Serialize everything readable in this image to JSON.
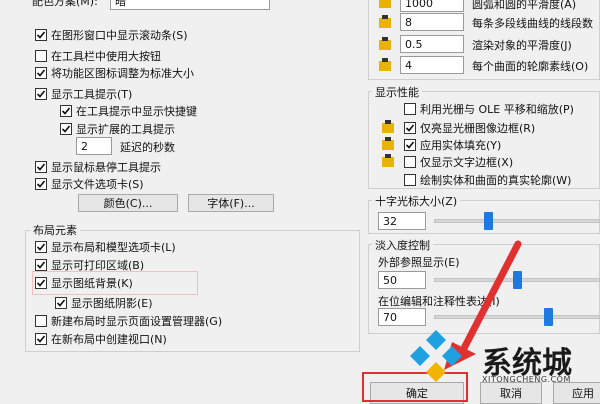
{
  "left": {
    "top_partial_label": "配色方案(M):",
    "top_partial_value": "暗",
    "display_options": [
      {
        "label": "在图形窗口中显示滚动条(S)",
        "checked": true
      },
      {
        "label": "在工具栏中使用大按钮",
        "checked": false
      },
      {
        "label": "将功能区图标调整为标准大小",
        "checked": true
      },
      {
        "label": "显示工具提示(T)",
        "checked": true
      }
    ],
    "tooltip_sub": [
      {
        "label": "在工具提示中显示快捷键",
        "checked": true
      },
      {
        "label": "显示扩展的工具提示",
        "checked": true
      }
    ],
    "delay_value": "2",
    "delay_label": "延迟的秒数",
    "more_options": [
      {
        "label": "显示鼠标悬停工具提示",
        "checked": true
      },
      {
        "label": "显示文件选项卡(S)",
        "checked": true
      }
    ],
    "color_button": "颜色(C)...",
    "font_button": "字体(F)...",
    "layout_group_title": "布局元素",
    "layout_options": [
      {
        "label": "显示布局和模型选项卡(L)",
        "checked": true
      },
      {
        "label": "显示可打印区域(B)",
        "checked": true
      },
      {
        "label": "显示图纸背景(K)",
        "checked": true
      }
    ],
    "layout_sub": {
      "label": "显示图纸阴影(E)",
      "checked": true
    },
    "layout_more": [
      {
        "label": "新建布局时显示页面设置管理器(G)",
        "checked": false
      },
      {
        "label": "在新布局中创建视口(N)",
        "checked": true
      }
    ]
  },
  "right": {
    "resolution_rows": [
      {
        "value": "1000",
        "label": "圆弧和圆的平滑度(A)"
      },
      {
        "value": "8",
        "label": "每条多段线曲线的线段数"
      },
      {
        "value": "0.5",
        "label": "渲染对象的平滑度(J)"
      },
      {
        "value": "4",
        "label": "每个曲面的轮廓素线(O)"
      }
    ],
    "performance_title": "显示性能",
    "performance_options": [
      {
        "label": "利用光栅与 OLE 平移和缩放(P)",
        "checked": false,
        "icon": false
      },
      {
        "label": "仅亮显光栅图像边框(R)",
        "checked": true,
        "icon": true
      },
      {
        "label": "应用实体填充(Y)",
        "checked": true,
        "icon": true
      },
      {
        "label": "仅显示文字边框(X)",
        "checked": false,
        "icon": true
      },
      {
        "label": "绘制实体和曲面的真实轮廓(W)",
        "checked": false,
        "icon": false
      }
    ],
    "crosshair_title": "十字光标大小(Z)",
    "crosshair_value": "32",
    "crosshair_fraction": 0.32,
    "fade_title": "淡入度控制",
    "xref_label": "外部参照显示(E)",
    "xref_value": "50",
    "xref_fraction": 0.5,
    "inplace_label": "在位编辑和注释性表达(I)",
    "inplace_value": "70",
    "inplace_fraction": 0.7
  },
  "buttons": {
    "ok": "确定",
    "cancel": "取消",
    "apply": "应用"
  },
  "watermark": {
    "brand": "系统城",
    "url": "XITONGCHENG.COM"
  },
  "colors": {
    "accent": "#1f7ae0",
    "highlight_box": "#e03030",
    "arrow": "#e03030"
  }
}
